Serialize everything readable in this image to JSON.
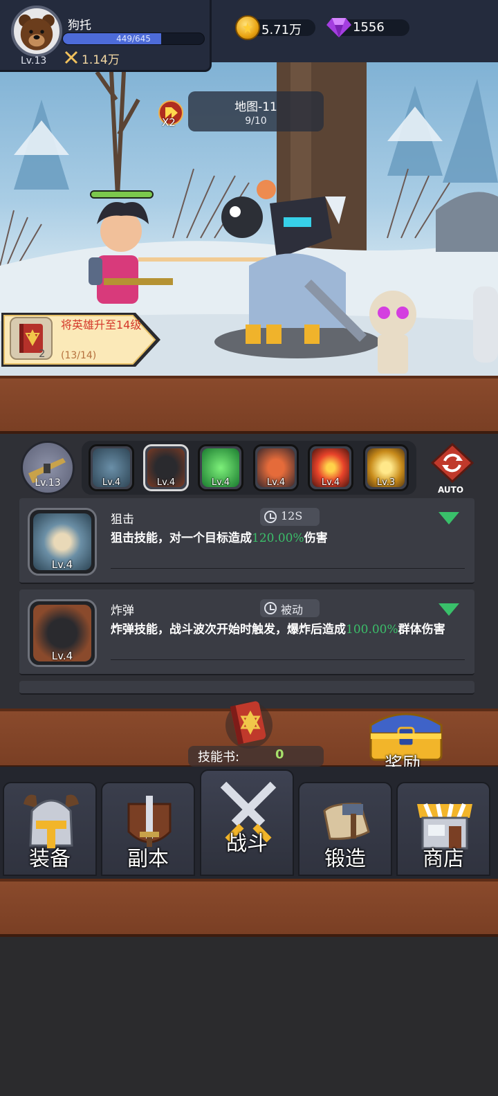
{
  "player": {
    "name": "狗托",
    "level_label": "Lv.13",
    "xp_text": "449/645",
    "xp_fraction": 0.696,
    "power": "1.14万"
  },
  "currency": {
    "gold": "5.71万",
    "gems": "1556"
  },
  "battle": {
    "map_title": "地图-11",
    "wave_progress": "9/10",
    "speed_label": "X2",
    "hero_hp_fraction": 1.0
  },
  "quest": {
    "text": "将英雄升至14级",
    "progress": "(13/14)",
    "reward_count": "2"
  },
  "skills_bar": {
    "weapon_level": "Lv.13",
    "slots": [
      {
        "name": "狙击",
        "level": "Lv.4",
        "icon": "sniper-icon"
      },
      {
        "name": "炸弹",
        "level": "Lv.4",
        "icon": "bomb-icon"
      },
      {
        "name": "poison",
        "level": "Lv.4",
        "icon": "poison-icon"
      },
      {
        "name": "rage",
        "level": "Lv.4",
        "icon": "rage-icon"
      },
      {
        "name": "fireball",
        "level": "Lv.4",
        "icon": "fireball-icon"
      },
      {
        "name": "lightning",
        "level": "Lv.3",
        "icon": "lightning-icon"
      }
    ],
    "auto_label": "AUTO"
  },
  "skill_cards": [
    {
      "name": "狙击",
      "tag": "12S",
      "level": "Lv.4",
      "desc_before": "狙击技能，对一个目标造成",
      "desc_value": "120.00%",
      "desc_after": "伤害"
    },
    {
      "name": "炸弹",
      "tag": "被动",
      "level": "Lv.4",
      "desc_before": "炸弹技能，战斗波次开始时触发，爆炸后造成",
      "desc_value": "100.00%",
      "desc_after": "群体伤害"
    }
  ],
  "skill_book": {
    "label": "技能书:",
    "count": "0"
  },
  "reward": {
    "label": "奖励"
  },
  "nav": {
    "tabs": [
      {
        "label": "装备",
        "icon": "helmet-icon"
      },
      {
        "label": "副本",
        "icon": "sword-shield-icon"
      },
      {
        "label": "战斗",
        "icon": "crossed-swords-icon",
        "active": true
      },
      {
        "label": "锻造",
        "icon": "scroll-hammer-icon"
      },
      {
        "label": "商店",
        "icon": "shop-icon"
      }
    ]
  },
  "colors": {
    "accent_green": "#3bbf6a",
    "quest_red": "#d4382a",
    "xp_blue": "#4d6bd8"
  }
}
